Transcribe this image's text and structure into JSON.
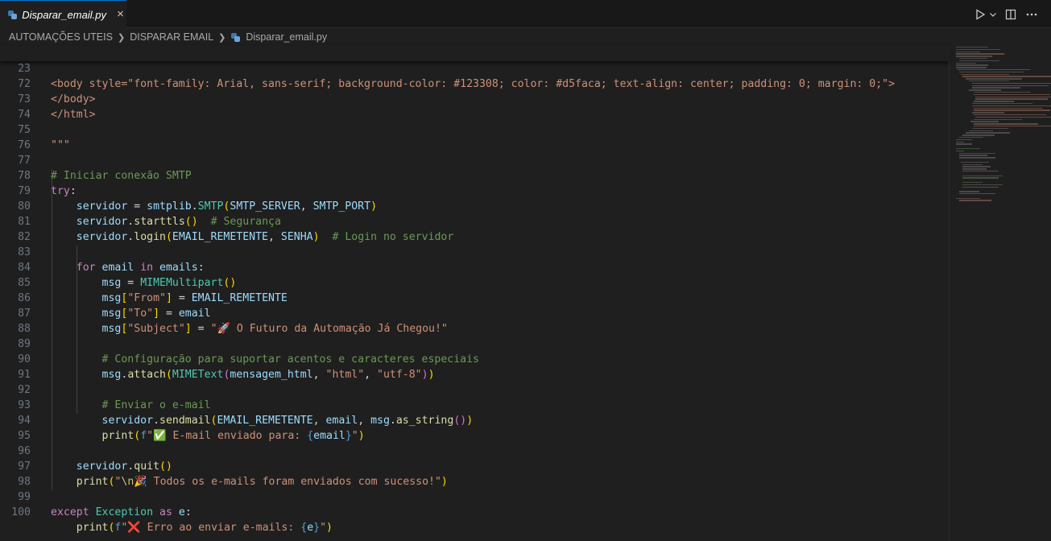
{
  "tab": {
    "icon": "python-file-icon",
    "label": "Disparar_email.py",
    "close": "×"
  },
  "actions": {
    "run_icon": "run-icon",
    "run_dropdown_icon": "chevron-down-icon",
    "split_icon": "split-editor-icon",
    "more_icon": "more-icon"
  },
  "breadcrumbs": {
    "items": [
      "AUTOMAÇÕES UTEIS",
      "DISPARAR EMAIL"
    ],
    "file": "Disparar_email.py"
  },
  "sticky": {
    "number": "23",
    "text": "<body style=\"font-family: Arial, sans-serif; background-color: #123308; color: #d5faca; text-align: center; padding: 0; margin: 0;\">"
  },
  "lines": {
    "n72": "72",
    "n73": "73",
    "n74": "74",
    "n75": "75",
    "n76": "76",
    "n77": "77",
    "n78": "78",
    "n79": "79",
    "n80": "80",
    "n81": "81",
    "n82": "82",
    "n83": "83",
    "n84": "84",
    "n85": "85",
    "n86": "86",
    "n87": "87",
    "n88": "88",
    "n89": "89",
    "n90": "90",
    "n91": "91",
    "n92": "92",
    "n93": "93",
    "n94": "94",
    "n95": "95",
    "n96": "96",
    "n97": "97",
    "n98": "98",
    "n99": "99",
    "n100": "100"
  },
  "code": {
    "l72": "</body>",
    "l73": "</html>",
    "l75": "\"\"\"",
    "l77": "# Iniciar conexão SMTP",
    "try": "try",
    "servidor": "servidor",
    "smtplib": "smtplib",
    "SMTP": "SMTP",
    "SMTP_SERVER": "SMTP_SERVER",
    "SMTP_PORT": "SMTP_PORT",
    "starttls": "starttls",
    "c80": "# Segurança",
    "login": "login",
    "EMAIL_REMETENTE": "EMAIL_REMETENTE",
    "SENHA": "SENHA",
    "c81": "# Login no servidor",
    "for": "for",
    "email": "email",
    "in": "in",
    "emails": "emails",
    "msg": "msg",
    "MIMEMultipart": "MIMEMultipart",
    "s_from": "\"From\"",
    "s_to": "\"To\"",
    "s_subject": "\"Subject\"",
    "s_subject_val": "\"🚀 O Futuro da Automação Já Chegou!\"",
    "c89": "# Configuração para suportar acentos e caracteres especiais",
    "attach": "attach",
    "MIMEText": "MIMEText",
    "mensagem_html": "mensagem_html",
    "s_html": "\"html\"",
    "s_utf8": "\"utf-8\"",
    "c92": "# Enviar o e-mail",
    "sendmail": "sendmail",
    "as_string": "as_string",
    "print": "print",
    "f": "f",
    "s94a": "\"✅ E-mail enviado para: ",
    "brace_open": "{",
    "brace_close": "}",
    "quote": "\"",
    "quit": "quit",
    "s97a": "\"",
    "esc_n": "\\n",
    "s97b": "🎉 Todos os e-mails foram enviados com sucesso!\"",
    "except": "except",
    "Exception": "Exception",
    "as": "as",
    "e": "e",
    "s100a": "\"❌ Erro ao enviar e-mails: "
  }
}
